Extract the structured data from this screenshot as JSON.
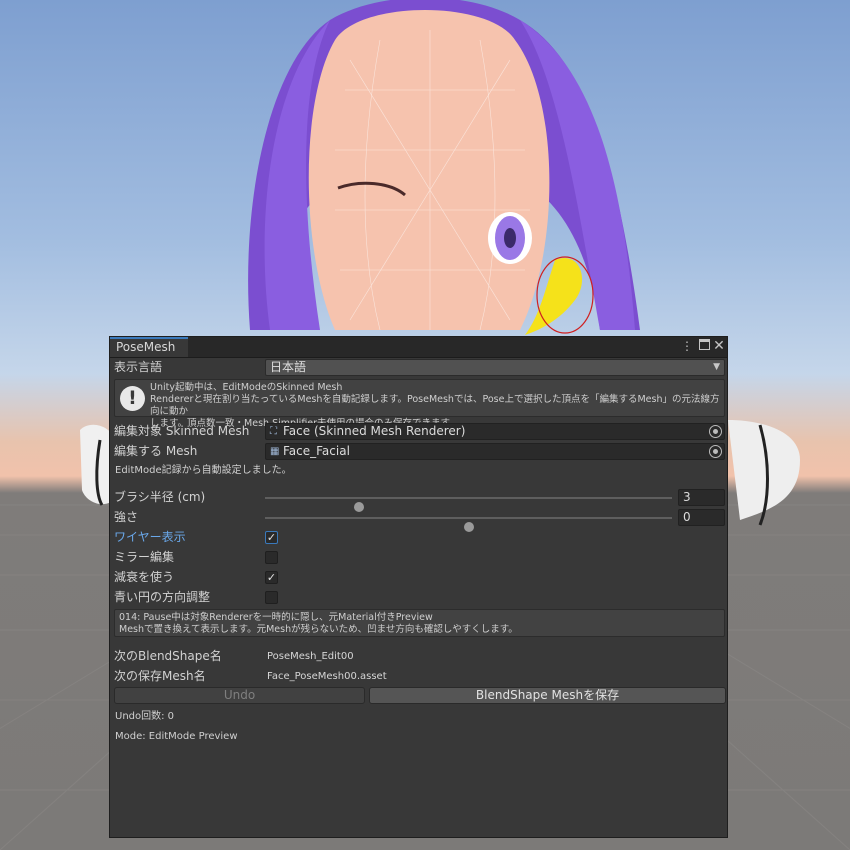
{
  "window": {
    "tab_title": "PoseMesh",
    "menu_icon": "kebab-menu-icon",
    "maximize_icon": "maximize-icon",
    "close_icon": "close-icon"
  },
  "language": {
    "label": "表示言語",
    "value": "日本語"
  },
  "help": {
    "icon": "warning-icon",
    "line1": "Unity起動中は、EditModeのSkinned Mesh",
    "line2": "Rendererと現在割り当たっているMeshを自動記録します。PoseMeshでは、Pose上で選択した頂点を「編集するMesh」の元法線方向に動か",
    "line3": "します。頂点数一致・Mesh Simplifier未使用の場合のみ保存できます。"
  },
  "target_renderer": {
    "label": "編集対象 Skinned Mesh",
    "value": "Face (Skinned Mesh Renderer)",
    "icon": "skinned-mesh-renderer-icon"
  },
  "edit_mesh": {
    "label": "編集する Mesh",
    "value": "Face_Facial",
    "icon": "mesh-icon"
  },
  "auto_note": "EditMode記録から自動設定しました。",
  "brush_radius": {
    "label": "ブラシ半径 (cm)",
    "value": "3",
    "level": 0.23
  },
  "strength": {
    "label": "強さ",
    "value": "0",
    "level": 0.5
  },
  "toggles": [
    {
      "label": "ワイヤー表示",
      "checked": true
    },
    {
      "label": "ミラー編集",
      "checked": false
    },
    {
      "label": "減衰を使う",
      "checked": true
    },
    {
      "label": "青い円の方向調整",
      "checked": false
    }
  ],
  "info": {
    "line1": "014: Pause中は対象Rendererを一時的に隠し、元Material付きPreview",
    "line2": "Meshで置き換えて表示します。元Meshが残らないため、凹ませ方向も確認しやすくします。"
  },
  "next_blendshape": {
    "label": "次のBlendShape名",
    "value": "PoseMesh_Edit00"
  },
  "next_mesh_name": {
    "label": "次の保存Mesh名",
    "value": "Face_PoseMesh00.asset"
  },
  "buttons": {
    "undo": "Undo",
    "save": "BlendShape Meshを保存"
  },
  "undo_count": "Undo回数: 0",
  "mode": "Mode: EditMode Preview",
  "colors": {
    "accent": "#3a79bb",
    "panel": "#383838",
    "hair": "#7a4fcf",
    "skin": "#f6c3ae",
    "highlight": "#f5e21a"
  }
}
